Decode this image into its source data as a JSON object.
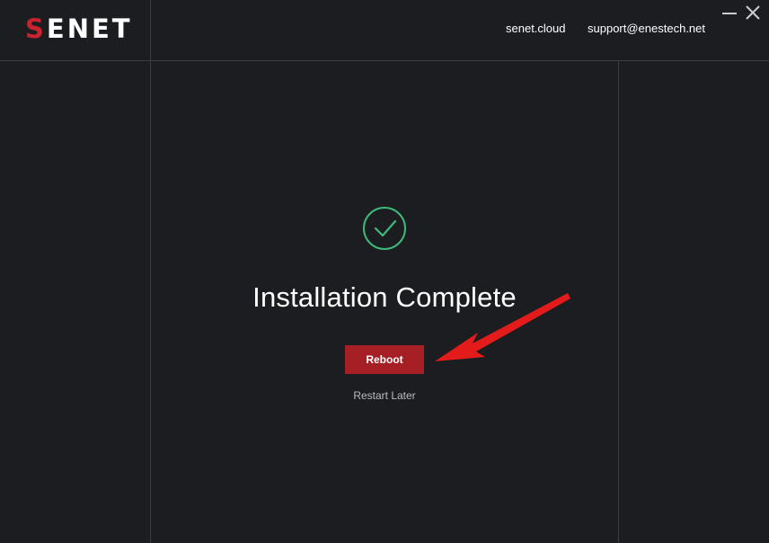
{
  "header": {
    "logo_s": "S",
    "logo_rest": "ENET",
    "links": {
      "site": "senet.cloud",
      "support": "support@enestech.net"
    }
  },
  "main": {
    "title": "Installation Complete",
    "reboot_label": "Reboot",
    "restart_later_label": "Restart Later"
  },
  "colors": {
    "background": "#1b1d21",
    "accent": "#a61f24",
    "success": "#3fb97a",
    "annotation_arrow": "#e31b1b"
  },
  "icons": {
    "success": "check-circle-icon",
    "minimize": "minimize-icon",
    "close": "close-icon",
    "annotation": "red-arrow-annotation"
  }
}
